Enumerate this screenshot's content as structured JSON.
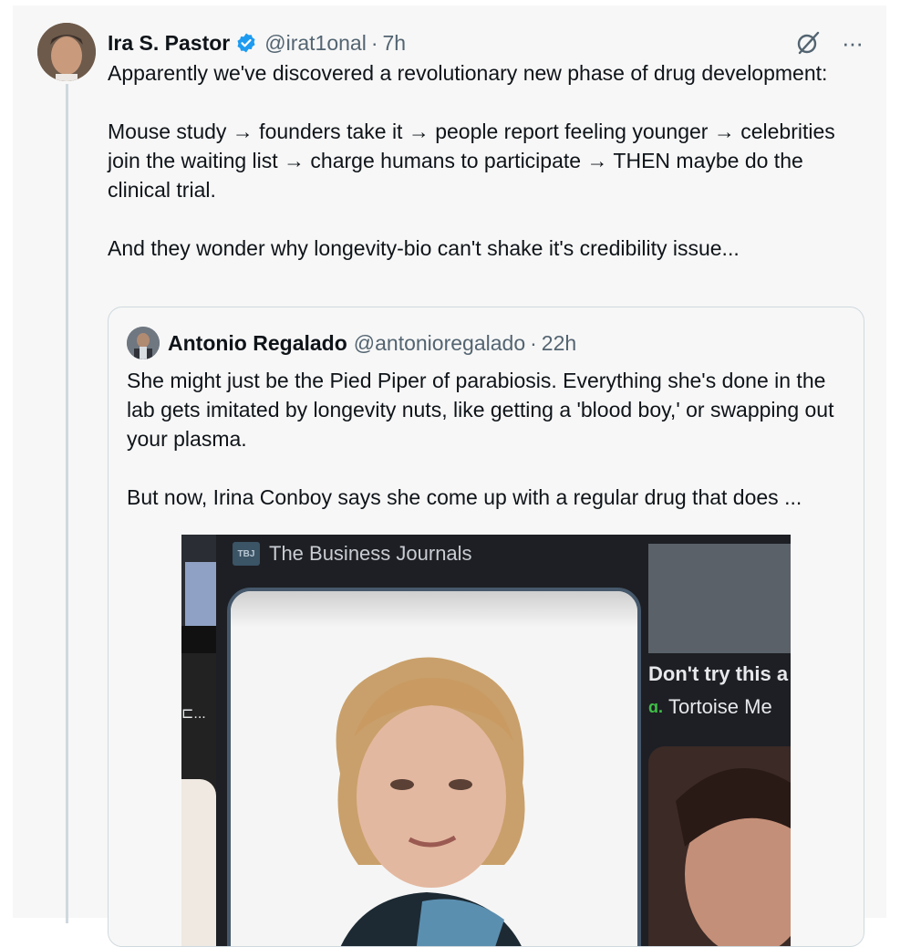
{
  "tweet": {
    "author_name": "Ira S. Pastor",
    "handle": "@irat1onal",
    "separator": "·",
    "time": "7h",
    "more_label": "···",
    "paragraphs": [
      "Apparently we've discovered a revolutionary new phase of drug development:",
      "Mouse study → founders take it → people report feeling younger → celebrities join the waiting list → charge humans to participate → THEN maybe do the clinical trial.",
      "And they wonder why longevity-bio can't shake it's credibility issue..."
    ]
  },
  "quote": {
    "author_name": "Antonio Regalado",
    "handle": "@antonioregalado",
    "separator": "·",
    "time": "22h",
    "paragraphs": [
      "She might just be the Pied Piper of parabiosis. Everything she's done in the lab gets imitated by longevity nuts, like getting a 'blood boy,' or swapping out your plasma.",
      "But now, Irina Conboy says she come up with a regular drug that does ..."
    ]
  },
  "media": {
    "source_logo_text": "TBJ",
    "source_name": "The Business Journals",
    "left_fragment": "⊏...",
    "right_title": "Don't try this a",
    "right_source_icon": "ɑ.",
    "right_source": "Tortoise Me"
  },
  "colors": {
    "verified": "#1d9bf0",
    "muted": "#536471",
    "card_bg": "#f7f7f7",
    "border": "#cfd9de"
  }
}
